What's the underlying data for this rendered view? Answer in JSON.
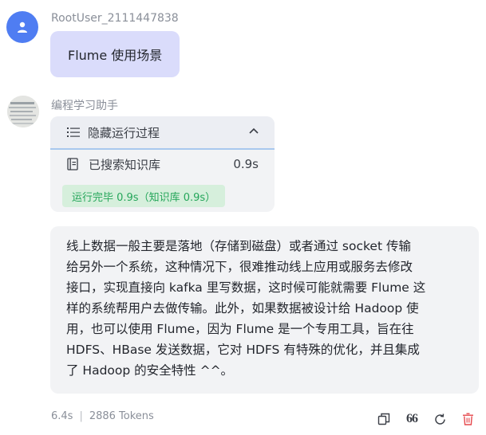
{
  "user": {
    "name": "RootUser_2111447838",
    "message": "Flume 使用场景"
  },
  "assistant": {
    "name": "编程学习助手",
    "process": {
      "toggle_label": "隐藏运行过程",
      "step_label": "已搜索知识库",
      "step_time": "0.9s",
      "status": "运行完毕 0.9s（知识库 0.9s）"
    },
    "answer_lines": [
      "线上数据一般主要是落地（存储到磁盘）或者通过 socket 传输",
      "给另外一个系统，这种情况下，很难推动线上应用或服务去修改",
      "接口，实现直接向 kafka 里写数据，这时候可能就需要 Flume 这",
      "样的系统帮用户去做传输。此外，如果数据被设计给 Hadoop 使",
      "用，也可以使用 Flume，因为 Flume 是一个专用工具，旨在往",
      "HDFS、HBase 发送数据，它对 HDFS 有特殊的优化，并且集成",
      "了 Hadoop 的安全特性 ^^。"
    ]
  },
  "footer": {
    "duration": "6.4s",
    "tokens": "2886 Tokens",
    "quote_label": "66"
  },
  "colors": {
    "user_avatar": "#4f7df2",
    "user_bubble": "#dadcfb",
    "panel": "#f2f3f5",
    "success_text": "#25a65a",
    "success_bg": "#d6efdc",
    "delete": "#e5484d"
  },
  "icons": [
    "user-icon",
    "list-icon",
    "chevron-up-icon",
    "database-icon",
    "copy-icon",
    "quote-icon",
    "refresh-icon",
    "trash-icon"
  ]
}
